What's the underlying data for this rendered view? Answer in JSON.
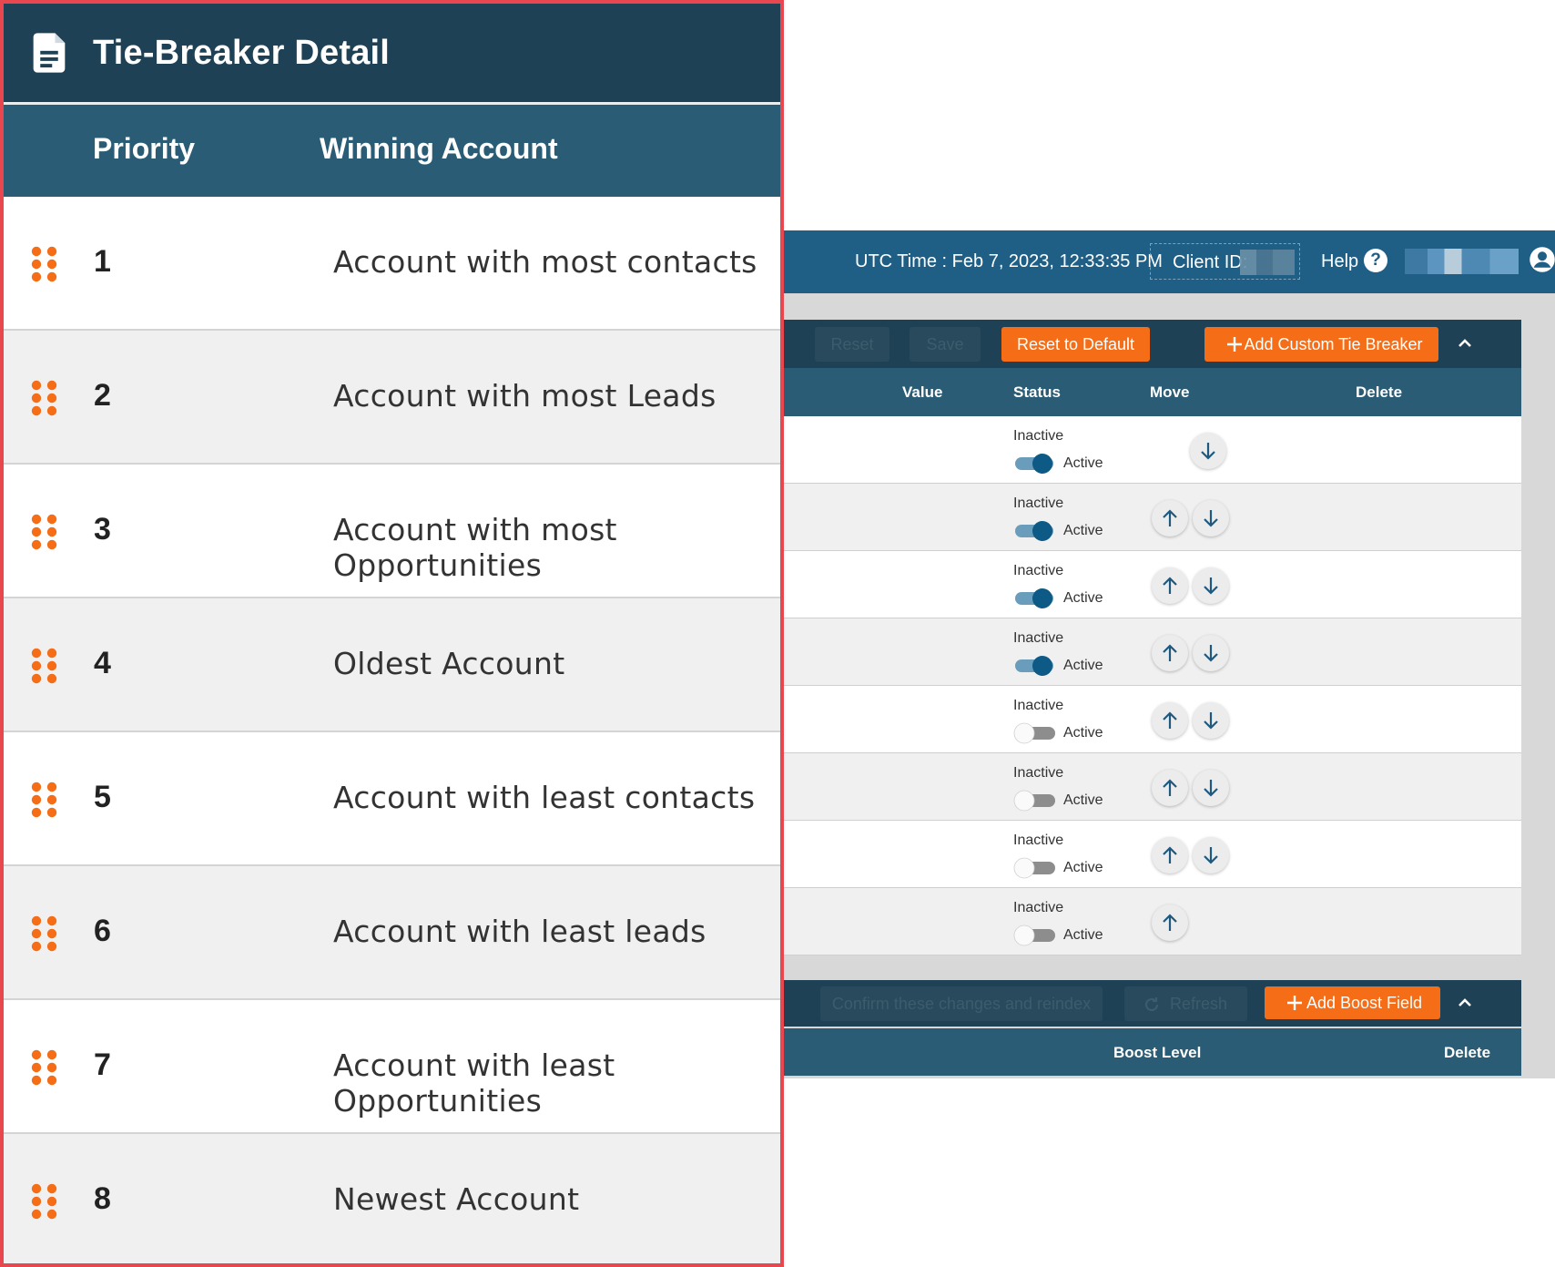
{
  "left_panel": {
    "title": "Tie-Breaker Detail",
    "columns": {
      "priority": "Priority",
      "winning_account": "Winning Account"
    },
    "rows": [
      {
        "priority": "1",
        "account": "Account with most contacts"
      },
      {
        "priority": "2",
        "account": "Account with most Leads"
      },
      {
        "priority": "3",
        "account": "Account with most Opportunities"
      },
      {
        "priority": "4",
        "account": "Oldest Account"
      },
      {
        "priority": "5",
        "account": "Account with least contacts"
      },
      {
        "priority": "6",
        "account": "Account with least leads"
      },
      {
        "priority": "7",
        "account": "Account with least Opportunities"
      },
      {
        "priority": "8",
        "account": "Newest Account"
      }
    ]
  },
  "topbar": {
    "utc_time": "UTC Time : Feb 7, 2023, 12:33:35 PM",
    "client_id_label": "Client ID:",
    "help_label": "Help",
    "help_icon": "?"
  },
  "tie_breaker_toolbar": {
    "reset_label": "Reset",
    "save_label": "Save",
    "reset_default_label": "Reset to Default",
    "add_custom_label": "Add Custom Tie Breaker"
  },
  "tie_breaker_columns": {
    "value": "Value",
    "status": "Status",
    "move": "Move",
    "delete": "Delete"
  },
  "tie_breaker_rows": [
    {
      "inactive": "Inactive",
      "active": "Active",
      "enabled": true
    },
    {
      "inactive": "Inactive",
      "active": "Active",
      "enabled": true
    },
    {
      "inactive": "Inactive",
      "active": "Active",
      "enabled": true
    },
    {
      "inactive": "Inactive",
      "active": "Active",
      "enabled": true
    },
    {
      "inactive": "Inactive",
      "active": "Active",
      "enabled": false
    },
    {
      "inactive": "Inactive",
      "active": "Active",
      "enabled": false
    },
    {
      "inactive": "Inactive",
      "active": "Active",
      "enabled": false
    },
    {
      "inactive": "Inactive",
      "active": "Active",
      "enabled": false
    }
  ],
  "boost_toolbar": {
    "confirm_label": "Confirm these changes and reindex",
    "refresh_label": "Refresh",
    "add_boost_label": "Add Boost Field"
  },
  "boost_columns": {
    "boost_level": "Boost Level",
    "delete": "Delete"
  },
  "colors": {
    "header_dark": "#1e4155",
    "header_mid": "#2a5c75",
    "topbar": "#1f5f86",
    "accent_orange": "#f56d16",
    "toggle_on": "#0c5a85",
    "zoom_border": "#e8474f"
  },
  "icons": {
    "title": "document-icon",
    "grip": "drag-grip-icon",
    "up": "arrow-up-icon",
    "down": "arrow-down-icon",
    "collapse": "chevron-up-icon",
    "add": "plus-icon",
    "refresh": "refresh-icon",
    "user": "user-circle-icon",
    "help": "help-circle-icon"
  }
}
